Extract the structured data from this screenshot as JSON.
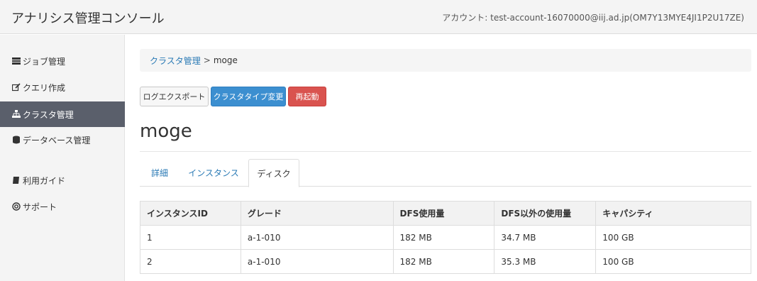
{
  "header": {
    "app_title": "アナリシス管理コンソール",
    "account": "アカウント: test-account-16070000@iij.ad.jp(OM7Y13MYE4JI1P2U17ZE)"
  },
  "sidebar": {
    "items": [
      {
        "label": "ジョブ管理",
        "icon": "list-icon",
        "active": false
      },
      {
        "label": "クエリ作成",
        "icon": "edit-icon",
        "active": false
      },
      {
        "label": "クラスタ管理",
        "icon": "sitemap-icon",
        "active": true
      },
      {
        "label": "データベース管理",
        "icon": "database-icon",
        "active": false
      },
      {
        "label": "利用ガイド",
        "icon": "book-icon",
        "active": false
      },
      {
        "label": "サポート",
        "icon": "lifebuoy-icon",
        "active": false
      }
    ]
  },
  "breadcrumb": {
    "parent": "クラスタ管理",
    "separator": ">",
    "current": "moge"
  },
  "actions": {
    "log_export": "ログエクスポート",
    "change_type": "クラスタタイプ変更",
    "restart": "再起動"
  },
  "page_title": "moge",
  "tabs": [
    {
      "label": "詳細",
      "active": false
    },
    {
      "label": "インスタンス",
      "active": false
    },
    {
      "label": "ディスク",
      "active": true
    }
  ],
  "table": {
    "headers": [
      "インスタンスID",
      "グレード",
      "DFS使用量",
      "DFS以外の使用量",
      "キャパシティ"
    ],
    "rows": [
      [
        "1",
        "a-1-010",
        "182 MB",
        "34.7 MB",
        "100 GB"
      ],
      [
        "2",
        "a-1-010",
        "182 MB",
        "35.3 MB",
        "100 GB"
      ]
    ]
  },
  "colors": {
    "primary": "#3c8fd0",
    "danger": "#d9534f",
    "sidebar_active": "#5a5f6b",
    "link": "#2a7ab5"
  }
}
